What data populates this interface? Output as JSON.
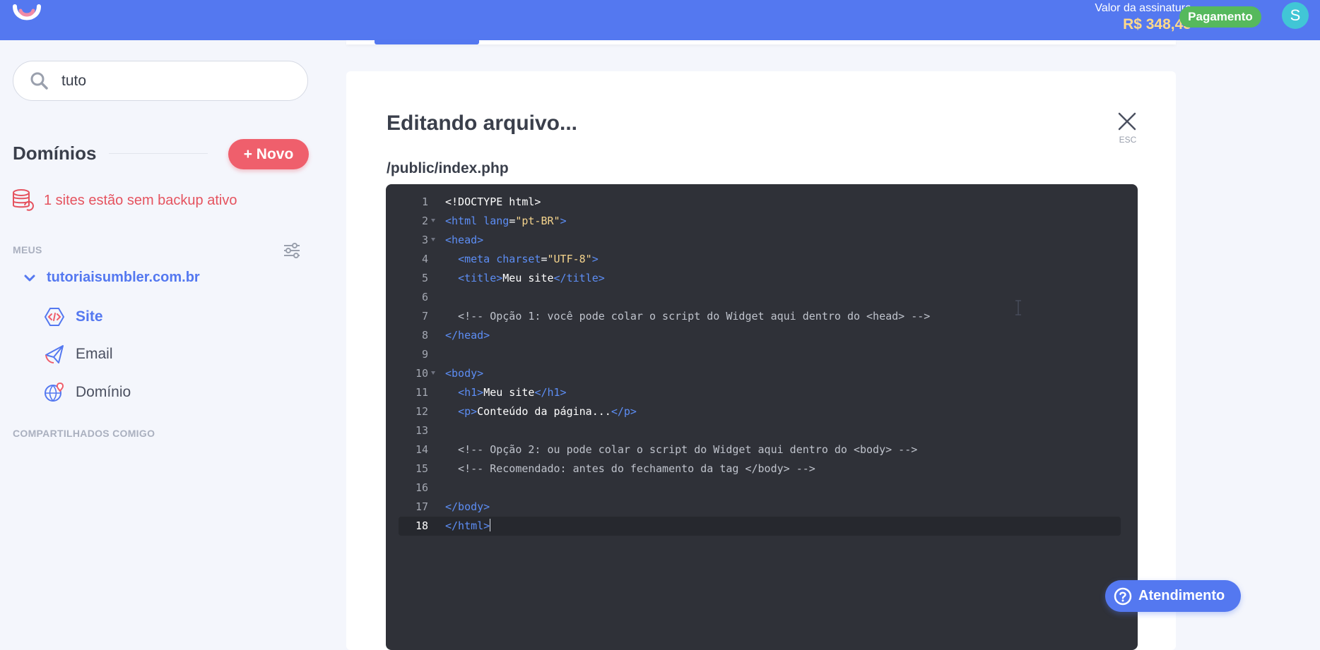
{
  "header": {
    "subscription_label": "Valor da assinatura",
    "subscription_value": "R$ 348,45",
    "payment_button": "Pagamento",
    "avatar_initial": "S"
  },
  "sidebar": {
    "search": {
      "value": "tuto",
      "placeholder": ""
    },
    "domains_title": "Domínios",
    "new_button": "+ Novo",
    "backup_warning": "1 sites estão sem backup ativo",
    "section_mine": "MEUS",
    "domain_name": "tutoriaisumbler.com.br",
    "nav": [
      {
        "label": "Site",
        "icon": "code-icon",
        "active": true
      },
      {
        "label": "Email",
        "icon": "paper-plane-icon",
        "active": false
      },
      {
        "label": "Domínio",
        "icon": "globe-pin-icon",
        "active": false
      }
    ],
    "section_shared": "COMPARTILHADOS COMIGO"
  },
  "editor": {
    "title": "Editando arquivo...",
    "close_hint": "ESC",
    "file_path": "/public/index.php",
    "active_line": 18,
    "lines": [
      {
        "n": "1",
        "foldable": false
      },
      {
        "n": "2",
        "foldable": true
      },
      {
        "n": "3",
        "foldable": true
      },
      {
        "n": "4",
        "foldable": false
      },
      {
        "n": "5",
        "foldable": false
      },
      {
        "n": "6",
        "foldable": false
      },
      {
        "n": "7",
        "foldable": false
      },
      {
        "n": "8",
        "foldable": false
      },
      {
        "n": "9",
        "foldable": false
      },
      {
        "n": "10",
        "foldable": true
      },
      {
        "n": "11",
        "foldable": false
      },
      {
        "n": "12",
        "foldable": false
      },
      {
        "n": "13",
        "foldable": false
      },
      {
        "n": "14",
        "foldable": false
      },
      {
        "n": "15",
        "foldable": false
      },
      {
        "n": "16",
        "foldable": false
      },
      {
        "n": "17",
        "foldable": false
      },
      {
        "n": "18",
        "foldable": false
      }
    ],
    "code": {
      "l1": "<!DOCTYPE html>",
      "l2_open": "<html",
      "l2_attr": " lang",
      "l2_eq": "=",
      "l2_val": "\"pt-BR\"",
      "l2_close": ">",
      "l3": "<head>",
      "l4_indent": "  ",
      "l4_open": "<meta",
      "l4_attr": " charset",
      "l4_eq": "=",
      "l4_val": "\"UTF-8\"",
      "l4_close": ">",
      "l5_indent": "  ",
      "l5_open": "<title>",
      "l5_text": "Meu site",
      "l5_close": "</title>",
      "l7": "  <!-- Opção 1: você pode colar o script do Widget aqui dentro do <head> -->",
      "l8": "</head>",
      "l10": "<body>",
      "l11_indent": "  ",
      "l11_open": "<h1>",
      "l11_text": "Meu site",
      "l11_close": "</h1>",
      "l12_indent": "  ",
      "l12_open": "<p>",
      "l12_text": "Conteúdo da página...",
      "l12_close": "</p>",
      "l14": "  <!-- Opção 2: ou pode colar o script do Widget aqui dentro do <body> -->",
      "l15": "  <!-- Recomendado: antes do fechamento da tag </body> -->",
      "l17": "</body>",
      "l18": "</html>"
    }
  },
  "support_button": "Atendimento",
  "colors": {
    "brand": "#5478f0",
    "danger": "#ef5f6c",
    "success": "#56b95d",
    "editor_bg": "#2f3138",
    "price": "#ffd98a"
  }
}
